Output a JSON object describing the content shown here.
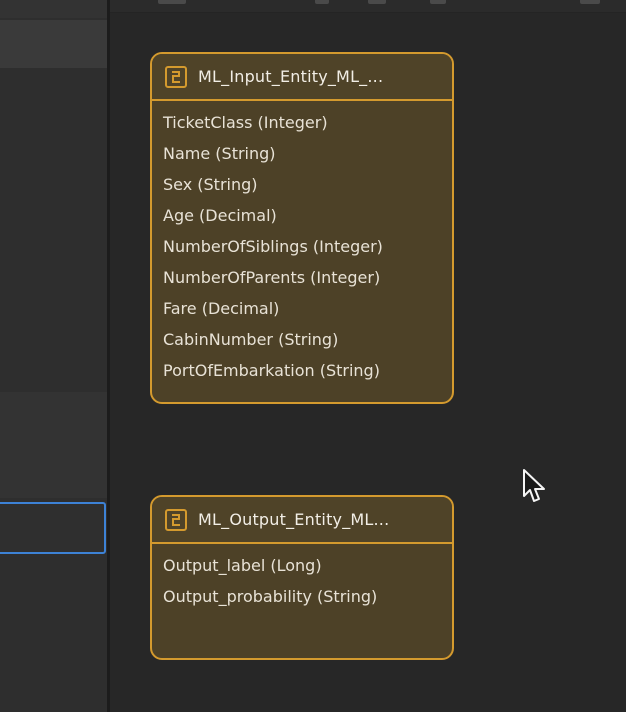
{
  "input_entity": {
    "title": "ML_Input_Entity_ML_...",
    "icon": "entity-icon",
    "attributes": [
      "TicketClass (Integer)",
      "Name (String)",
      "Sex (String)",
      "Age (Decimal)",
      "NumberOfSiblings (Integer)",
      "NumberOfParents (Integer)",
      "Fare (Decimal)",
      "CabinNumber (String)",
      "PortOfEmbarkation (String)"
    ]
  },
  "output_entity": {
    "title": "ML_Output_Entity_ML...",
    "icon": "entity-icon",
    "attributes": [
      "Output_label (Long)",
      "Output_probability (String)"
    ]
  },
  "colors": {
    "canvas_bg": "#272727",
    "entity_border": "#d49a2e",
    "entity_fill": "#4d4127",
    "selection_border": "#3d82d6"
  }
}
